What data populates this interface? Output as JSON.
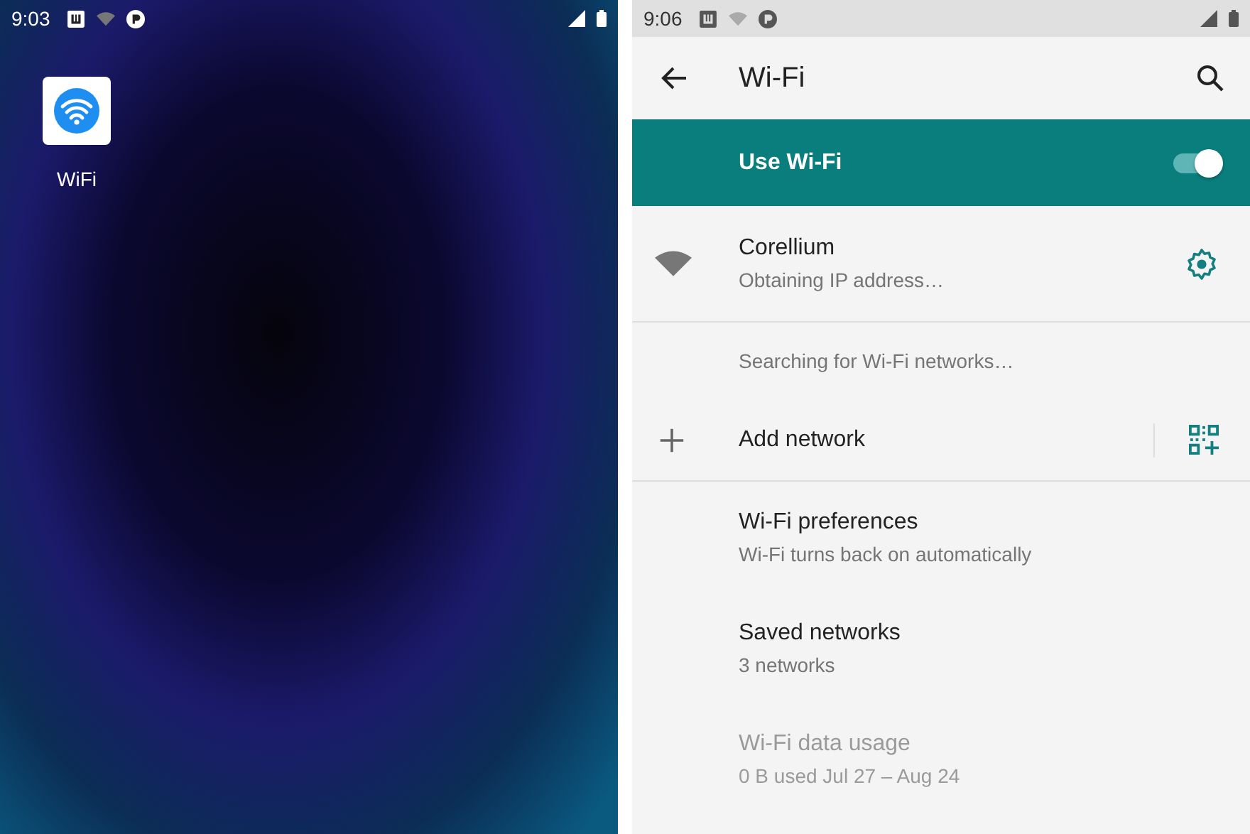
{
  "home": {
    "status_bar": {
      "time": "9:03"
    },
    "apps": [
      {
        "label": "WiFi"
      }
    ]
  },
  "settings": {
    "status_bar": {
      "time": "9:06"
    },
    "title": "Wi-Fi",
    "master": {
      "label": "Use Wi-Fi",
      "on": true
    },
    "networks": [
      {
        "name": "Corellium",
        "status": "Obtaining IP address…"
      }
    ],
    "scan_status": "Searching for Wi-Fi networks…",
    "add_network": {
      "label": "Add network"
    },
    "preferences": [
      {
        "title": "Wi-Fi preferences",
        "summary": "Wi-Fi turns back on automatically",
        "disabled": false
      },
      {
        "title": "Saved networks",
        "summary": "3 networks",
        "disabled": false
      },
      {
        "title": "Wi-Fi data usage",
        "summary": "0 B used Jul 27 – Aug 24",
        "disabled": true
      }
    ]
  }
}
